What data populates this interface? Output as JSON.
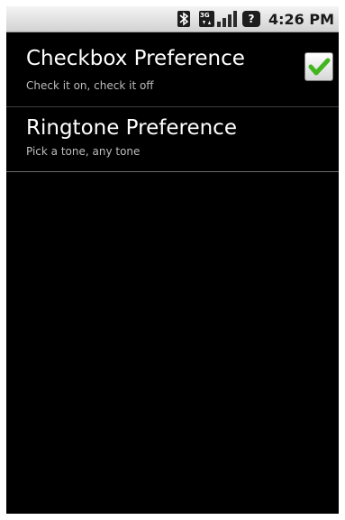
{
  "status_bar": {
    "time": "4:26 PM",
    "network_label": "3G",
    "icons": [
      "bluetooth-icon",
      "3g-data-icon",
      "signal-strength-icon",
      "unknown-notification-icon"
    ]
  },
  "preferences": [
    {
      "title": "Checkbox Preference",
      "summary": "Check it on, check it off",
      "checked": true
    },
    {
      "title": "Ringtone Preference",
      "summary": "Pick a tone, any tone"
    }
  ],
  "colors": {
    "background": "#000000",
    "check_green": "#43b51f",
    "title_text": "#ffffff",
    "summary_text": "#bdbdbd"
  }
}
